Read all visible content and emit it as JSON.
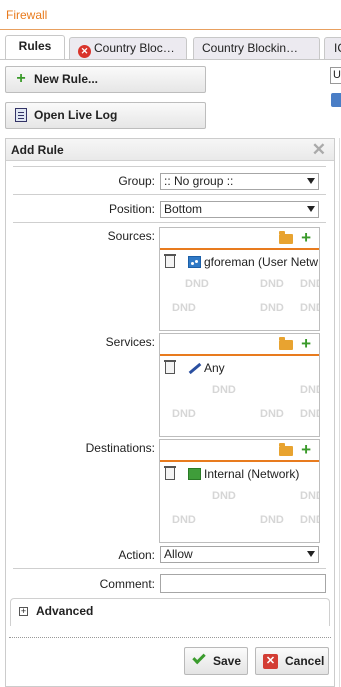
{
  "app": {
    "title": "Firewall"
  },
  "tabs": [
    {
      "label": "Rules"
    },
    {
      "label": "Country Bloc…"
    },
    {
      "label": "Country Blockin…"
    },
    {
      "label": "IC"
    }
  ],
  "toolbar": {
    "new_rule": "New Rule...",
    "open_live_log": "Open Live Log",
    "side_input_value": "U"
  },
  "dialog": {
    "title": "Add Rule",
    "group": {
      "label": "Group:",
      "value": ":: No group ::"
    },
    "position": {
      "label": "Position:",
      "value": "Bottom"
    },
    "sources": {
      "label": "Sources:",
      "items": [
        {
          "text": "gforeman (User Netw",
          "icon": "user-network-icon"
        }
      ]
    },
    "services": {
      "label": "Services:",
      "items": [
        {
          "text": "Any",
          "icon": "any-icon"
        }
      ]
    },
    "destinations": {
      "label": "Destinations:",
      "items": [
        {
          "text": "Internal (Network)",
          "icon": "network-icon"
        }
      ]
    },
    "dnd_text": "DND",
    "action": {
      "label": "Action:",
      "value": "Allow"
    },
    "comment": {
      "label": "Comment:",
      "value": ""
    },
    "advanced": {
      "label": "Advanced"
    },
    "save": "Save",
    "cancel": "Cancel"
  },
  "colors": {
    "accent": "#e87b1e",
    "add_green": "#3a9a2a",
    "cancel_red": "#d33d34"
  }
}
